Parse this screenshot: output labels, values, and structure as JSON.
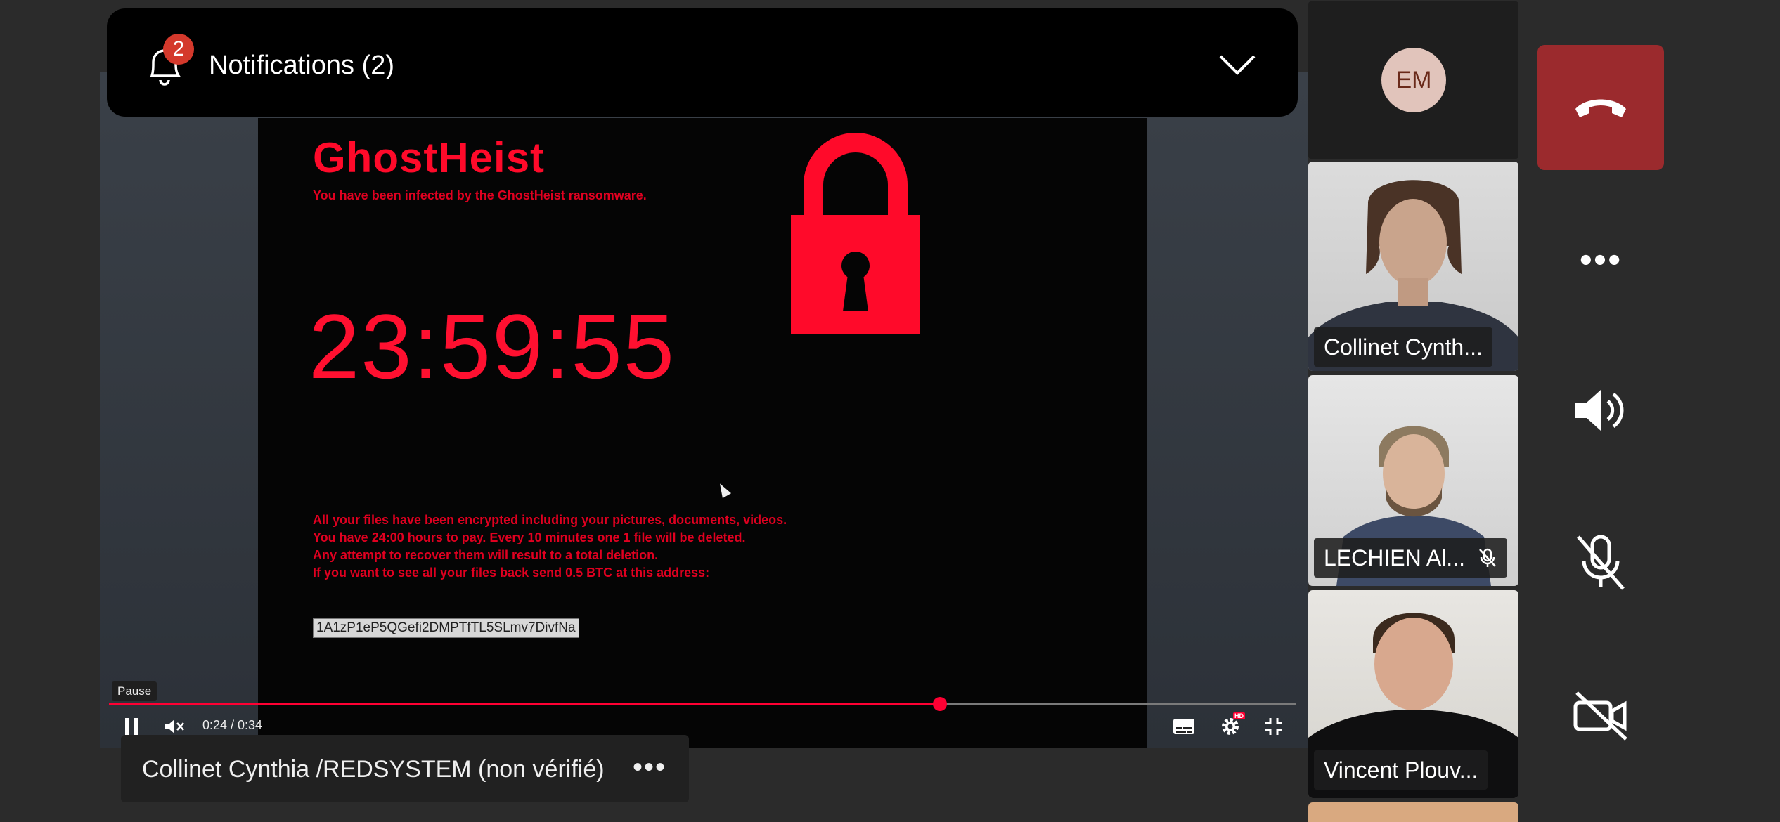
{
  "notifications": {
    "title": "Notifications (2)",
    "badge_count": "2"
  },
  "shared_screen": {
    "title": "GhostHeist",
    "subtitle": "You have been infected by the GhostHeist ransomware.",
    "timer": "23:59:55",
    "message_lines": [
      "All your files have been encrypted including your pictures, documents, videos.",
      "You have 24:00 hours to pay. Every 10 minutes one 1 file will be deleted.",
      "Any attempt to recover them will result to a total deletion.",
      "If you want to see all your files back send 0.5 BTC at this address:"
    ],
    "btc_address": "1A1zP1eP5QGefi2DMPTfTL5SLmv7DivfNa"
  },
  "player": {
    "tooltip": "Pause",
    "time_display": "0:24 / 0:34",
    "progress": 0.7,
    "hd_badge": "HD"
  },
  "presenter": {
    "name": "Collinet Cynthia /REDSYSTEM (non vérifié)",
    "more_label": "•••"
  },
  "participants": [
    {
      "initials": "EM"
    },
    {
      "label": "Collinet Cynth..."
    },
    {
      "label": "LECHIEN Al...",
      "muted": true
    },
    {
      "label": "Vincent Plouv..."
    }
  ],
  "controls": {
    "more_label": "•••"
  },
  "colors": {
    "hangup": "#9b2a2d",
    "badge": "#d4392c",
    "ransom_red": "#ff0a2a",
    "progress": "#ff0033"
  }
}
